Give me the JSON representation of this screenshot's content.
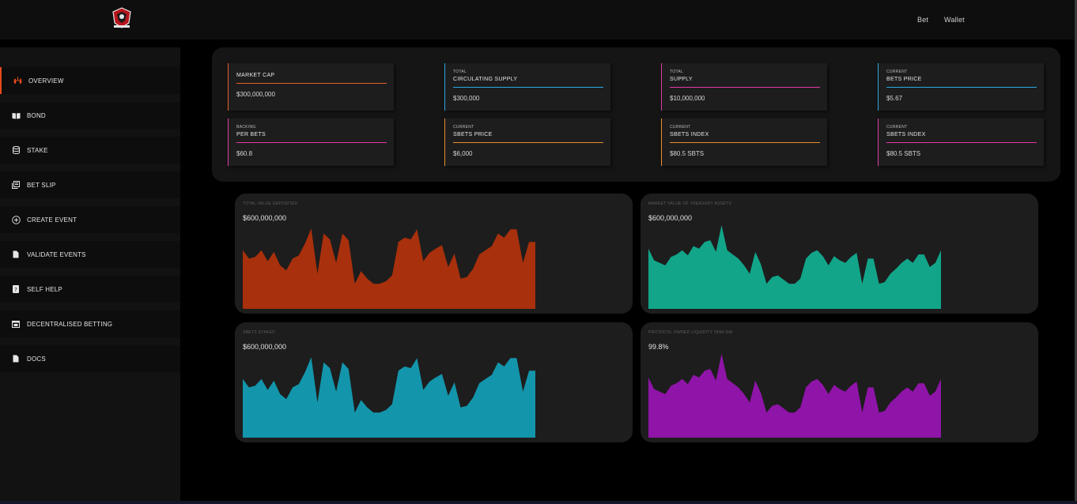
{
  "header": {
    "logo": "bets-logo",
    "nav": [
      "Bet",
      "Wallet"
    ]
  },
  "sidebar": {
    "items": [
      {
        "label": "OVERVIEW",
        "icon": "lungs-icon",
        "active": true
      },
      {
        "label": "BOND",
        "icon": "book-icon"
      },
      {
        "label": "STAKE",
        "icon": "database-icon"
      },
      {
        "label": "BET SLIP",
        "icon": "cards-icon"
      },
      {
        "label": "CREATE EVENT",
        "icon": "plus-circle-icon"
      },
      {
        "label": "VALIDATE EVENTS",
        "icon": "document-icon"
      },
      {
        "label": "SELF HELP",
        "icon": "question-icon"
      },
      {
        "label": "DECENTRALISED BETTING",
        "icon": "calendar-icon"
      },
      {
        "label": "DOCS",
        "icon": "document-icon"
      }
    ]
  },
  "stats": [
    {
      "small": "",
      "title": "MARKET CAP",
      "value": "$300,000,000",
      "color": "#e8602c"
    },
    {
      "small": "TOTAL",
      "title": "CIRCULATING SUPPLY",
      "value": "$300,000",
      "color": "#2aa8e0"
    },
    {
      "small": "TOTAL",
      "title": "SUPPLY",
      "value": "$10,000,000",
      "color": "#e03aa8"
    },
    {
      "small": "CURRENT",
      "title": "BETS PRICE",
      "value": "$5.67",
      "color": "#2aa8e0"
    },
    {
      "small": "BACKING",
      "title": "PER BETS",
      "value": "$60.8",
      "color": "#e03aa8"
    },
    {
      "small": "CURRENT",
      "title": "SBETS PRICE",
      "value": "$6,000",
      "color": "#e8902c"
    },
    {
      "small": "CURRENT",
      "title": "SBETS INDEX",
      "value": "$80.5 SBTS",
      "color": "#e8902c"
    },
    {
      "small": "CURRENT",
      "title": "SBETS INDEX",
      "value": "$80.5 SBTS",
      "color": "#e03aa8"
    }
  ],
  "charts": [
    {
      "label": "TOTAL VALUE DEPOSITED",
      "value": "$600,000,000",
      "color": "#a8300c"
    },
    {
      "label": "MARKET VALUE OF TREASURY ASSETS",
      "value": "$600,000,000",
      "color": "#12a589"
    },
    {
      "label": "SBETS STAKED",
      "value": "$600,000,000",
      "color": "#1395ab"
    },
    {
      "label": "PROTOCOL OWNED LIQUIDITY OHM-DAI",
      "value": "99.8%",
      "color": "#8f14a8"
    }
  ],
  "chart_data": [
    {
      "type": "area",
      "title": "TOTAL VALUE DEPOSITED",
      "series": [
        {
          "values": [
            70,
            60,
            62,
            70,
            57,
            68,
            52,
            46,
            60,
            64,
            78,
            96,
            42,
            90,
            83,
            55,
            90,
            82,
            30,
            45,
            36,
            30,
            30,
            33,
            40,
            80,
            85,
            83,
            95,
            57,
            67,
            72,
            76,
            50,
            66,
            36,
            38,
            48,
            65,
            70,
            75,
            90,
            85,
            95,
            95,
            55,
            80,
            80
          ]
        }
      ],
      "ylim": [
        0,
        100
      ]
    },
    {
      "type": "area",
      "title": "MARKET VALUE OF TREASURY ASSETS",
      "series": [
        {
          "values": [
            72,
            58,
            55,
            52,
            62,
            65,
            70,
            64,
            75,
            72,
            80,
            82,
            68,
            100,
            70,
            65,
            60,
            52,
            42,
            68,
            53,
            30,
            38,
            40,
            35,
            30,
            30,
            36,
            60,
            67,
            70,
            63,
            52,
            63,
            58,
            55,
            62,
            67,
            30,
            60,
            60,
            30,
            32,
            42,
            48,
            55,
            60,
            55,
            65,
            65,
            50,
            55,
            70
          ]
        }
      ],
      "ylim": [
        0,
        100
      ]
    },
    {
      "type": "area",
      "title": "SBETS STAKED",
      "series": [
        {
          "values": [
            70,
            60,
            62,
            70,
            57,
            68,
            52,
            46,
            60,
            64,
            78,
            96,
            42,
            90,
            83,
            55,
            90,
            82,
            30,
            45,
            36,
            30,
            30,
            33,
            40,
            80,
            85,
            83,
            95,
            57,
            67,
            72,
            76,
            50,
            66,
            36,
            38,
            48,
            65,
            70,
            75,
            90,
            85,
            95,
            95,
            55,
            80,
            80
          ]
        }
      ],
      "ylim": [
        0,
        100
      ]
    },
    {
      "type": "area",
      "title": "PROTOCOL OWNED LIQUIDITY OHM-DAI",
      "series": [
        {
          "values": [
            72,
            58,
            55,
            52,
            62,
            65,
            70,
            64,
            75,
            72,
            80,
            82,
            68,
            100,
            70,
            65,
            60,
            52,
            42,
            68,
            53,
            30,
            38,
            40,
            35,
            30,
            30,
            36,
            60,
            67,
            70,
            63,
            52,
            63,
            58,
            55,
            62,
            67,
            30,
            60,
            60,
            30,
            32,
            42,
            48,
            55,
            60,
            55,
            65,
            65,
            50,
            55,
            70
          ]
        }
      ],
      "ylim": [
        0,
        100
      ]
    }
  ]
}
